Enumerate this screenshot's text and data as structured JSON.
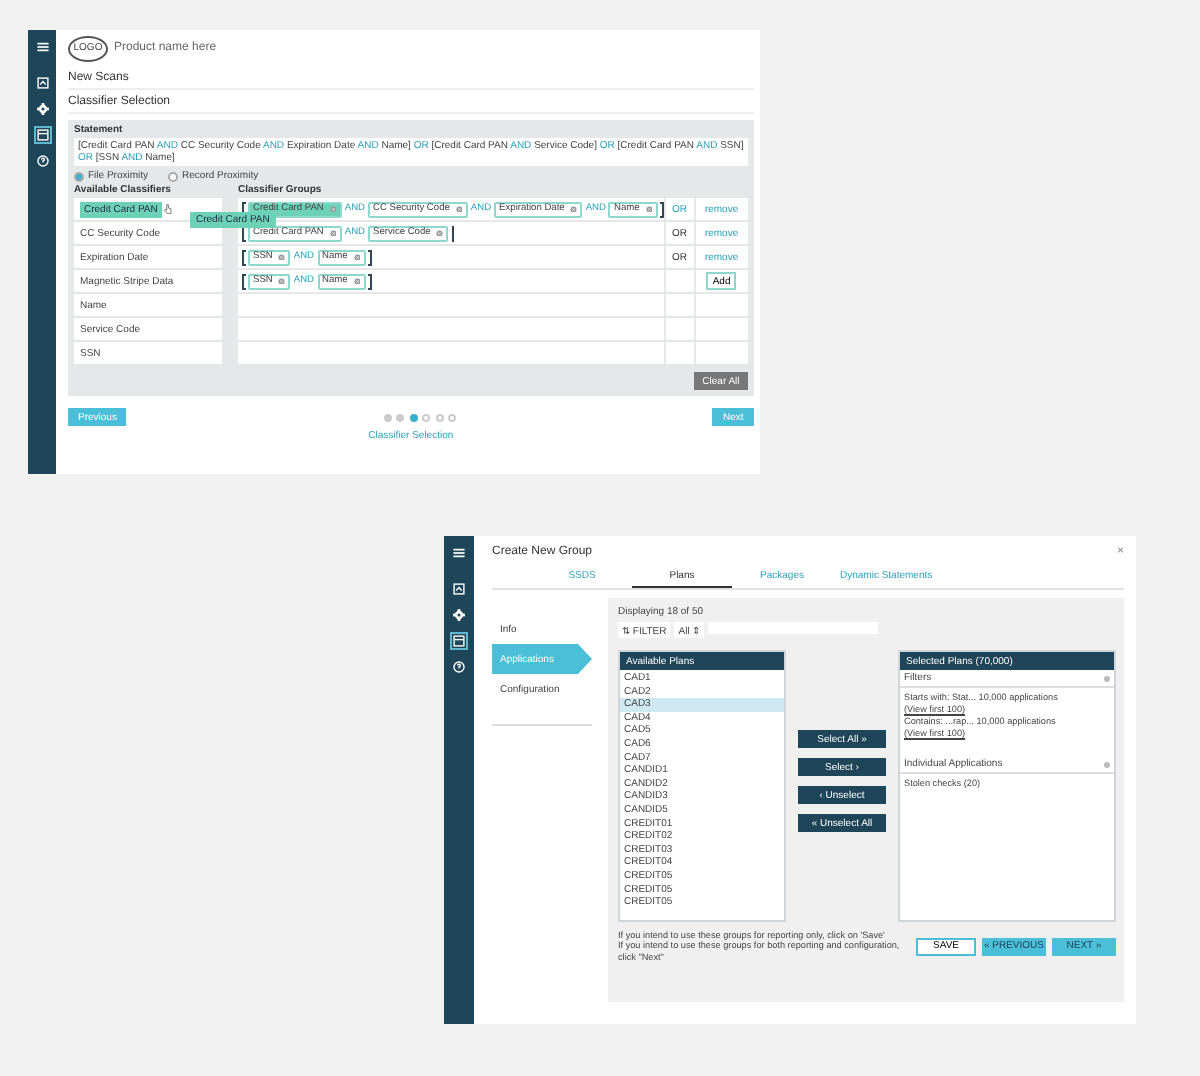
{
  "top_window": {
    "sidebar_icons": [
      {
        "kind": "menu",
        "selected": false
      },
      {
        "kind": "scan",
        "selected": false
      },
      {
        "kind": "settings",
        "selected": false
      },
      {
        "kind": "list",
        "selected": true
      },
      {
        "kind": "help",
        "selected": false
      }
    ],
    "logo": "LOGO",
    "product": "Product name here",
    "breadcrumb": "New Scans",
    "section_title": "Classifier Selection",
    "statement": {
      "label": "Statement",
      "tokens": [
        {
          "kind": "term",
          "text": "[Credit Card PAN"
        },
        {
          "kind": "op",
          "text": "AND"
        },
        {
          "kind": "term",
          "text": "CC Security Code"
        },
        {
          "kind": "op",
          "text": "AND"
        },
        {
          "kind": "term",
          "text": "Expiration Date"
        },
        {
          "kind": "op",
          "text": "AND"
        },
        {
          "kind": "term",
          "text": "Name]"
        },
        {
          "kind": "op",
          "text": "OR"
        },
        {
          "kind": "term",
          "text": "[Credit Card PAN"
        },
        {
          "kind": "op",
          "text": "AND"
        },
        {
          "kind": "term",
          "text": "Service Code]"
        },
        {
          "kind": "op",
          "text": "OR"
        },
        {
          "kind": "term",
          "text": "[Credit Card PAN"
        },
        {
          "kind": "op",
          "text": "AND"
        },
        {
          "kind": "term",
          "text": "SSN]"
        },
        {
          "kind": "op",
          "text": "OR"
        },
        {
          "kind": "term",
          "text": "[SSN"
        },
        {
          "kind": "op",
          "text": "AND"
        },
        {
          "kind": "term",
          "text": "Name]"
        }
      ]
    },
    "proximity": [
      {
        "label": "File Proximity",
        "selected": true
      },
      {
        "label": "Record Proximity",
        "selected": false
      }
    ],
    "available_title": "Available Classifiers",
    "available": [
      {
        "label": "Credit Card PAN",
        "selected": true
      },
      {
        "label": "CC Security Code",
        "selected": false
      },
      {
        "label": "Expiration Date",
        "selected": false
      },
      {
        "label": "Magnetic Stripe Data",
        "selected": false
      },
      {
        "label": "Name",
        "selected": false
      },
      {
        "label": "Service Code",
        "selected": false
      },
      {
        "label": "SSN",
        "selected": false
      }
    ],
    "drag_ghost": "Credit Card PAN",
    "groups_title": "Classifier Groups",
    "groups": [
      {
        "chips": [
          {
            "label": "Credit Card PAN",
            "selected": true
          },
          {
            "label": "CC Security Code",
            "selected": false,
            "connector": "AND"
          },
          {
            "label": "Expiration Date",
            "selected": false,
            "connector": "AND"
          },
          {
            "label": "Name",
            "selected": false,
            "connector": "AND"
          }
        ],
        "operator": "OR",
        "operator_active": true,
        "action": "remove",
        "kind": "link"
      },
      {
        "chips": [
          {
            "label": "Credit Card PAN",
            "selected": false
          },
          {
            "label": "Service Code",
            "selected": false,
            "connector": "AND"
          }
        ],
        "operator": "OR",
        "operator_active": false,
        "action": "remove",
        "kind": "link"
      },
      {
        "chips": [
          {
            "label": "SSN",
            "selected": false
          },
          {
            "label": "Name",
            "selected": false,
            "connector": "AND"
          }
        ],
        "operator": "OR",
        "operator_active": false,
        "action": "remove",
        "kind": "link"
      },
      {
        "chips": [
          {
            "label": "SSN",
            "selected": false
          },
          {
            "label": "Name",
            "selected": false,
            "connector": "AND"
          }
        ],
        "action": "Add",
        "kind": "button"
      }
    ],
    "clear_all": "Clear All",
    "previous": "Previous",
    "next": "Next",
    "steps": [
      {
        "done": true,
        "selected": false
      },
      {
        "done": true,
        "selected": false
      },
      {
        "done": false,
        "selected": true
      },
      {
        "done": false,
        "selected": false
      },
      {
        "done": false,
        "selected": false
      },
      {
        "done": false,
        "selected": false
      }
    ],
    "step_caption": "Classifier Selection"
  },
  "bottom_window": {
    "sidebar_icons": [
      {
        "kind": "menu",
        "selected": false
      },
      {
        "kind": "scan",
        "selected": false
      },
      {
        "kind": "settings",
        "selected": false
      },
      {
        "kind": "list",
        "selected": true
      },
      {
        "kind": "help",
        "selected": false
      }
    ],
    "title": "Create New Group",
    "close": "×",
    "tabs": [
      {
        "label": "SSDS",
        "selected": false
      },
      {
        "label": "Plans",
        "selected": true
      },
      {
        "label": "Packages",
        "selected": false
      },
      {
        "label": "Dynamic Statements",
        "selected": false
      }
    ],
    "steps": [
      {
        "label": "Info",
        "selected": false
      },
      {
        "label": "Applications",
        "selected": true
      },
      {
        "label": "Configuration",
        "selected": false
      }
    ],
    "displaying": "Displaying 18 of 50",
    "filter": "⇅ FILTER",
    "scope": "All ⇕",
    "available_title": "Available Plans",
    "plans": [
      {
        "label": "CAD1",
        "selected": false
      },
      {
        "label": "CAD2",
        "selected": false
      },
      {
        "label": "CAD3",
        "selected": true
      },
      {
        "label": "CAD4",
        "selected": false
      },
      {
        "label": "CAD5",
        "selected": false
      },
      {
        "label": "CAD6",
        "selected": false
      },
      {
        "label": "CAD7",
        "selected": false
      },
      {
        "label": "CANDID1",
        "selected": false
      },
      {
        "label": "CANDID2",
        "selected": false
      },
      {
        "label": "CANDID3",
        "selected": false
      },
      {
        "label": "CANDID5",
        "selected": false
      },
      {
        "label": "CREDIT01",
        "selected": false
      },
      {
        "label": "CREDIT02",
        "selected": false
      },
      {
        "label": "CREDIT03",
        "selected": false
      },
      {
        "label": "CREDIT04",
        "selected": false
      },
      {
        "label": "CREDIT05",
        "selected": false
      },
      {
        "label": "CREDIT05",
        "selected": false
      },
      {
        "label": "CREDIT05",
        "selected": false
      }
    ],
    "move_buttons": [
      "Select All  »",
      "Select  ›",
      "‹  Unselect",
      "«  Unselect All"
    ],
    "selected_title": "Selected Plans (70,000)",
    "filters_title": "Filters",
    "filters": [
      {
        "text": "Starts with: Stat... 10,000 applications",
        "link": "(View first 100)"
      },
      {
        "text": "Contains: ...rap... 10,000 applications",
        "link": "(View first 100)"
      }
    ],
    "individual_title": "Individual Applications",
    "individual": [
      "Stolen checks (20)"
    ],
    "notes": [
      "If you intend to use these groups for reporting only, click on 'Save'",
      "If you intend to use these groups for both reporting and configuration, click \"Next\""
    ],
    "save": "SAVE",
    "previous": "« PREVIOUS",
    "next": "NEXT »"
  }
}
